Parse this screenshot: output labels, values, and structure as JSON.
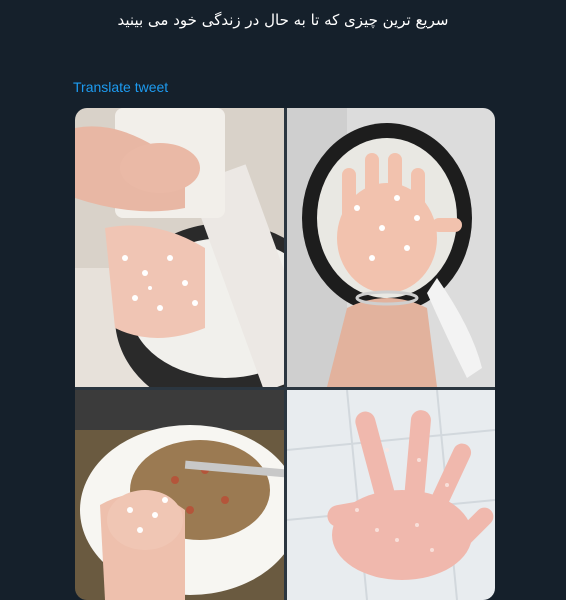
{
  "tweet": {
    "text": "سریع ترین چیزی که تا به حال در زندگی خود می بینید",
    "translate_label": "Translate tweet"
  },
  "media": {
    "photos": [
      {
        "subject": "hand-in-rice-cooker-with-spoon"
      },
      {
        "subject": "baby-hand-over-rice-pot"
      },
      {
        "subject": "baby-fist-on-plate-of-food"
      },
      {
        "subject": "baby-hand-covered-in-rice-on-tiles"
      }
    ]
  },
  "colors": {
    "background": "#15202b",
    "text": "#ffffff",
    "link": "#1d9bf0"
  }
}
